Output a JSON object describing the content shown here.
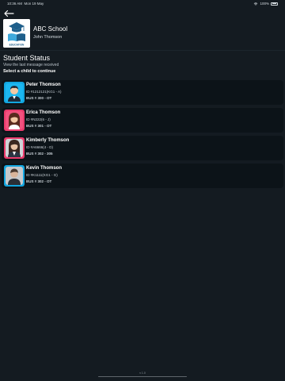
{
  "status_bar": {
    "time": "10:36 AM",
    "date": "Mon 19 May",
    "battery": "100%"
  },
  "header": {
    "school_name": "ABC School",
    "parent_name": "John Thomson",
    "logo_text": "EDUCATION"
  },
  "section": {
    "title": "Student Status",
    "subtitle": "View the last message received",
    "instruction": "Select a child to continue"
  },
  "students": [
    {
      "name": "Peter Thomson",
      "id": "ID #1212121(KG1 - A)",
      "bus": "BUS # 300 - OT",
      "avatar_bg": "#12a6e0"
    },
    {
      "name": "Erica Thomson",
      "id": "ID #N222(6 - J)",
      "bus": "BUS # 301 - OT",
      "avatar_bg": "#e93b6c"
    },
    {
      "name": "Kimberly Thomson",
      "id": "ID #A6666(4 - D)",
      "bus": "BUS # 302 - 305",
      "avatar_bg": "#e93b6c"
    },
    {
      "name": "Kevin Thomson",
      "id": "ID #K1111(KG1 - G)",
      "bus": "BUS # 302 - OT",
      "avatar_bg": "#12a6e0"
    }
  ],
  "footer": {
    "version": "v 1.0"
  },
  "colors": {
    "background": "#141b21",
    "card": "#0c1318",
    "logo_blue": "#1f5f8b"
  }
}
